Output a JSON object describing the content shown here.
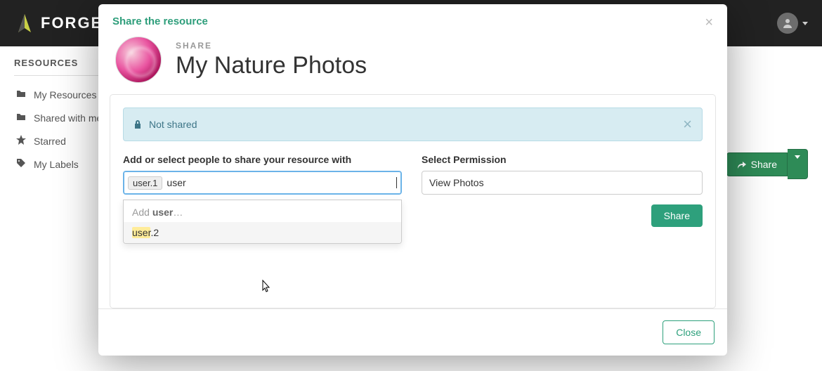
{
  "brand": {
    "name": "FORGE"
  },
  "sidebar": {
    "heading": "RESOURCES",
    "items": [
      {
        "label": "My Resources",
        "icon": "folder"
      },
      {
        "label": "Shared with me",
        "icon": "folder"
      },
      {
        "label": "Starred",
        "icon": "star"
      },
      {
        "label": "My Labels",
        "icon": "tag"
      }
    ]
  },
  "toolbar": {
    "share_label": "Share"
  },
  "modal": {
    "title": "Share the resource",
    "subhead_eyebrow": "SHARE",
    "resource_title": "My Nature Photos",
    "alert_text": "Not shared",
    "people_label": "Add or select people to share your resource with",
    "permission_label": "Select Permission",
    "tokens": [
      "user.1"
    ],
    "typed": "user",
    "dropdown": {
      "add_prefix": "Add ",
      "add_query": "user",
      "add_suffix": "…",
      "option_highlight": "user",
      "option_rest": ".2"
    },
    "permission_value": "View Photos",
    "share_button": "Share",
    "close_button": "Close"
  }
}
